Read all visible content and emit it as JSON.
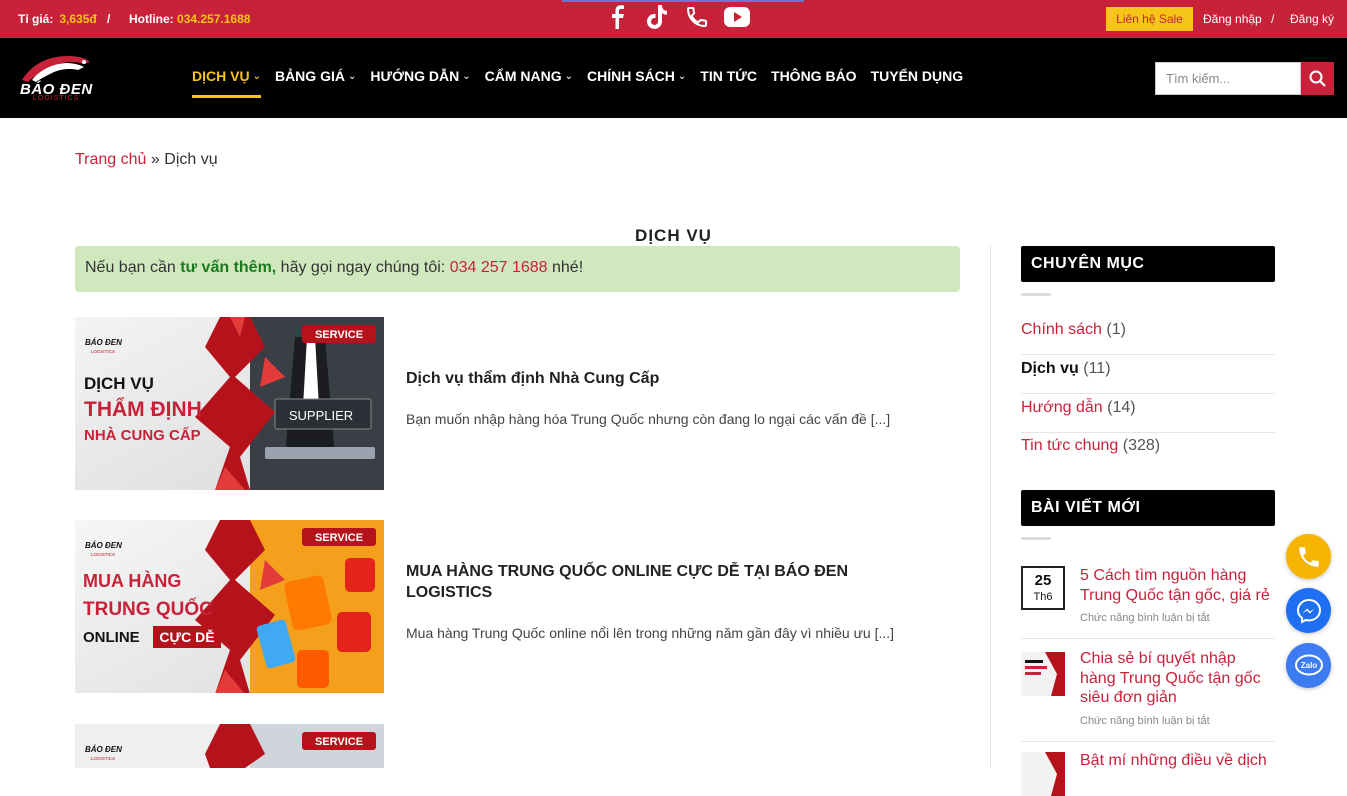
{
  "topbar": {
    "rate_label": "Tỉ giá:",
    "rate_value": "3,635đ",
    "separator": "/",
    "hotline_label": "Hotline:",
    "hotline_value": "034.257.1688",
    "socials": [
      "facebook-icon",
      "tiktok-icon",
      "phone-icon",
      "youtube-icon"
    ],
    "sale_button": "Liên hệ Sale",
    "login": "Đăng nhập",
    "slash": "/",
    "register": "Đăng ký"
  },
  "header": {
    "logo_text": "BÁO ĐEN",
    "logo_sub": "LOGISTICS",
    "nav": [
      {
        "label": "DỊCH VỤ",
        "dropdown": true,
        "active": true
      },
      {
        "label": "BẢNG GIÁ",
        "dropdown": true
      },
      {
        "label": "HƯỚNG DẪN",
        "dropdown": true
      },
      {
        "label": "CẨM NANG",
        "dropdown": true
      },
      {
        "label": "CHÍNH SÁCH",
        "dropdown": true
      },
      {
        "label": "TIN TỨC",
        "dropdown": false
      },
      {
        "label": "THÔNG BÁO",
        "dropdown": false
      },
      {
        "label": "TUYỂN DỤNG",
        "dropdown": false
      }
    ],
    "search_placeholder": "Tìm kiếm..."
  },
  "breadcrumb": {
    "home": "Trang chủ",
    "sep": "»",
    "current": "Dịch vụ"
  },
  "page_title": "DỊCH VỤ",
  "notice": {
    "before": "Nếu bạn cần ",
    "highlight": "tư vấn thêm,",
    "middle": " hãy gọi ngay chúng tôi: ",
    "phone": "034 257 1688",
    "after": " nhé!"
  },
  "posts": [
    {
      "title": "Dịch vụ thẩm định Nhà Cung Cấp",
      "excerpt": "Bạn muốn nhập hàng hóa Trung Quốc nhưng còn đang lo ngại các vấn đề [...]",
      "thumb": {
        "badge": "SERVICE",
        "logo": "BÁO ĐEN",
        "logo_sub": "LOGISTICS",
        "line1": "DỊCH VỤ",
        "line2": "THẨM ĐỊNH",
        "line3": "NHÀ CUNG CẤP",
        "sign": "SUPPLIER"
      }
    },
    {
      "title": "MUA HÀNG TRUNG QUỐC ONLINE CỰC DỄ TẠI BÁO ĐEN LOGISTICS",
      "excerpt": "Mua hàng Trung Quốc online nổi lên trong những năm gần đây vì nhiều ưu [...]",
      "thumb": {
        "badge": "SERVICE",
        "logo": "BÁO ĐEN",
        "logo_sub": "LOGISTICS",
        "line1": "MUA HÀNG",
        "line2": "TRUNG QUỐC",
        "line3a": "ONLINE",
        "line3b": "CỰC DỄ"
      }
    },
    {
      "title": "",
      "excerpt": "",
      "thumb": {
        "badge": "SERVICE",
        "logo": "BÁO ĐEN",
        "logo_sub": "LOGISTICS"
      }
    }
  ],
  "sidebar": {
    "categories_title": "CHUYÊN MỤC",
    "categories": [
      {
        "name": "Chính sách",
        "count": "(1)"
      },
      {
        "name": "Dịch vụ",
        "count": "(11)",
        "active": true
      },
      {
        "name": "Hướng dẫn",
        "count": "(14)"
      },
      {
        "name": "Tin tức chung",
        "count": "(328)"
      }
    ],
    "recent_title": "BÀI VIẾT MỚI",
    "recent": [
      {
        "day": "25",
        "month": "Th6",
        "title": "5 Cách tìm nguồn hàng Trung Quốc tận gốc, giá rẻ",
        "comments": "Chức năng bình luận bị tắt"
      },
      {
        "title": "Chia sẻ bí quyết nhập hàng Trung Quốc tận gốc siêu đơn giản",
        "comments": "Chức năng bình luận bị tắt"
      },
      {
        "title": "Bật mí những điều về dịch"
      }
    ]
  },
  "floating": [
    "phone-icon",
    "messenger-icon",
    "zalo-icon"
  ],
  "floating_labels": {
    "zalo": "Zalo"
  },
  "colors": {
    "brand_red": "#c8223a",
    "accent_yellow": "#f5c518",
    "notice_bg": "#cfe8be",
    "header_bg": "#000000"
  }
}
